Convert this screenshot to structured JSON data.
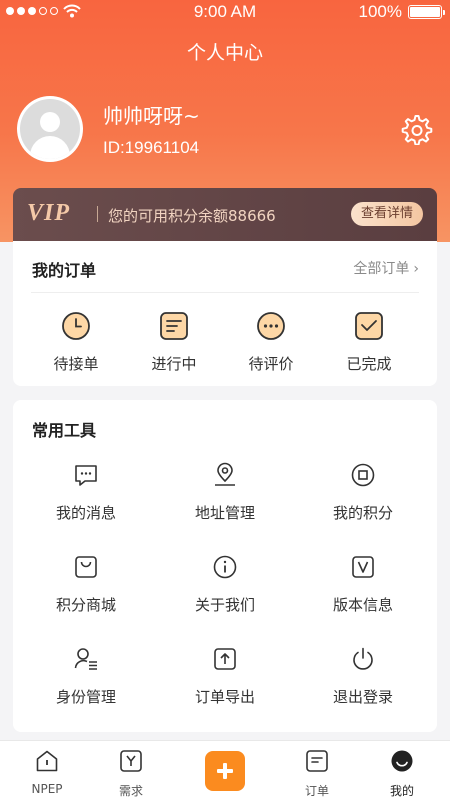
{
  "status_bar": {
    "time": "9:00 AM",
    "battery": "100%"
  },
  "page_title": "个人中心",
  "profile": {
    "name": "帅帅呀呀~",
    "id": "ID:19961104"
  },
  "vip": {
    "logo": "VIP",
    "text": "您的可用积分余额88666",
    "button": "查看详情"
  },
  "orders": {
    "title": "我的订单",
    "view_all": "全部订单",
    "items": [
      {
        "label": "待接单",
        "icon": "clock-icon"
      },
      {
        "label": "进行中",
        "icon": "list-icon"
      },
      {
        "label": "待评价",
        "icon": "comment-icon"
      },
      {
        "label": "已完成",
        "icon": "check-box-icon"
      }
    ]
  },
  "tools": {
    "title": "常用工具",
    "items": [
      {
        "label": "我的消息",
        "icon": "message-icon"
      },
      {
        "label": "地址管理",
        "icon": "location-pin-icon"
      },
      {
        "label": "我的积分",
        "icon": "points-coin-icon"
      },
      {
        "label": "积分商城",
        "icon": "shopping-bag-icon"
      },
      {
        "label": "关于我们",
        "icon": "info-icon"
      },
      {
        "label": "版本信息",
        "icon": "version-icon"
      },
      {
        "label": "身份管理",
        "icon": "user-list-icon"
      },
      {
        "label": "订单导出",
        "icon": "export-icon"
      },
      {
        "label": "退出登录",
        "icon": "power-icon"
      }
    ]
  },
  "tabbar": {
    "items": [
      {
        "label": "NPEP",
        "icon": "home-icon"
      },
      {
        "label": "需求",
        "icon": "demand-icon"
      },
      {
        "label": "",
        "icon": "add-icon"
      },
      {
        "label": "订单",
        "icon": "order-icon"
      },
      {
        "label": "我的",
        "icon": "profile-icon"
      }
    ],
    "active": "我的"
  },
  "colors": {
    "header": "#f8653f",
    "accent": "#fb8b1f",
    "vip_bg": "#5a3e40",
    "vip_gold": "#f4c9a8"
  }
}
